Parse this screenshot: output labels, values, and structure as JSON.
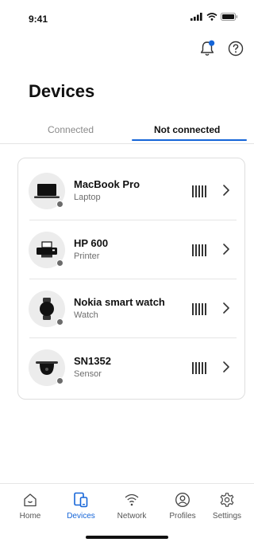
{
  "status_bar": {
    "time": "9:41"
  },
  "header": {
    "title": "Devices",
    "notification_badge_color": "#1565d8"
  },
  "tabs": [
    {
      "label": "Connected",
      "active": false
    },
    {
      "label": "Not connected",
      "active": true
    }
  ],
  "devices": [
    {
      "name": "MacBook Pro",
      "type": "Laptop",
      "icon": "laptop-icon"
    },
    {
      "name": "HP 600",
      "type": "Printer",
      "icon": "printer-icon"
    },
    {
      "name": "Nokia smart watch",
      "type": "Watch",
      "icon": "watch-icon"
    },
    {
      "name": "SN1352",
      "type": "Sensor",
      "icon": "sensor-icon"
    }
  ],
  "bottom_nav": [
    {
      "label": "Home",
      "icon": "home-icon",
      "active": false
    },
    {
      "label": "Devices",
      "icon": "devices-icon",
      "active": true
    },
    {
      "label": "Network",
      "icon": "wifi-icon",
      "active": false
    },
    {
      "label": "Profiles",
      "icon": "profile-icon",
      "active": false
    },
    {
      "label": "Settings",
      "icon": "gear-icon",
      "active": false
    }
  ],
  "colors": {
    "accent": "#1565d8",
    "text_primary": "#111111",
    "text_secondary": "#6d6d6d"
  }
}
